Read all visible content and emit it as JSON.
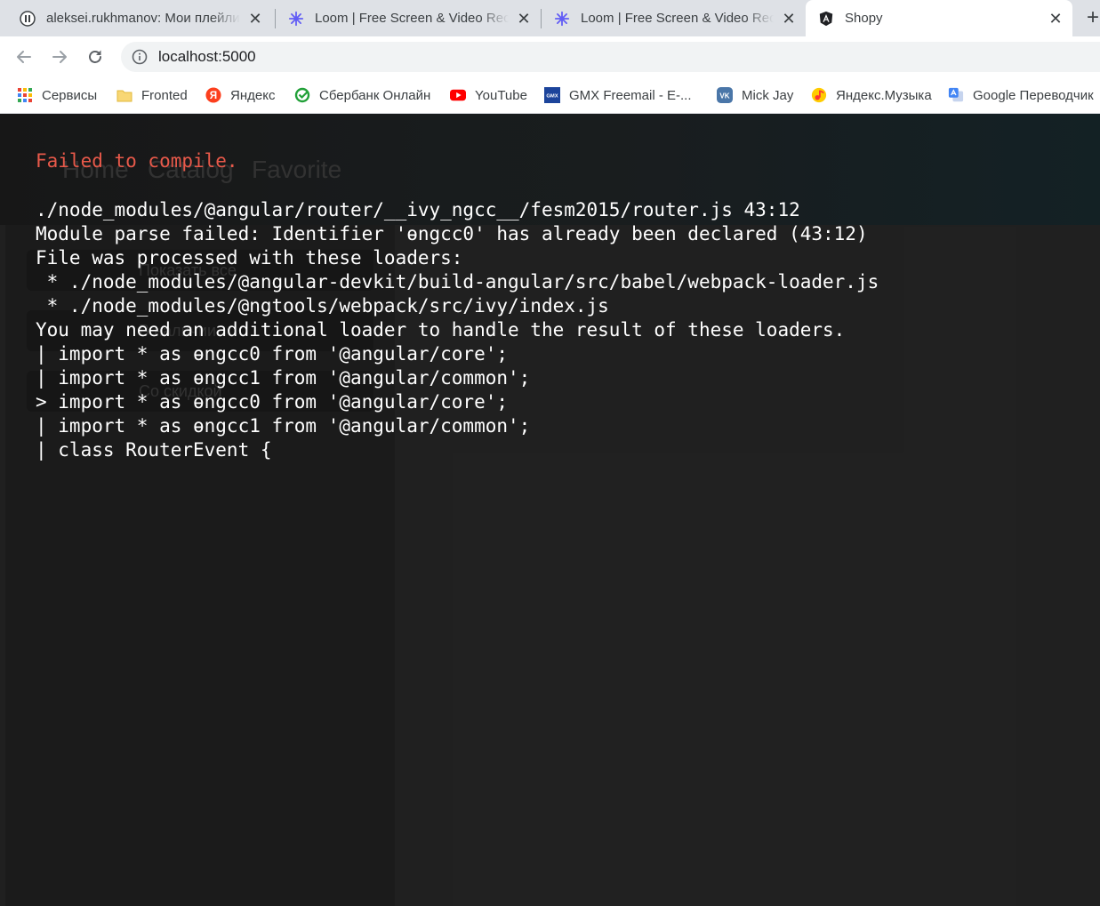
{
  "browser": {
    "tabs": [
      {
        "title": "aleksei.rukhmanov: Мои плейлисты",
        "icon": "pause-icon",
        "active": false
      },
      {
        "title": "Loom | Free Screen & Video Recording",
        "icon": "loom-icon",
        "active": false
      },
      {
        "title": "Loom | Free Screen & Video Recording",
        "icon": "loom-icon",
        "active": false
      },
      {
        "title": "Shopy",
        "icon": "angular-icon",
        "active": true
      }
    ],
    "new_tab": "+",
    "close_glyph": "✕",
    "url": "localhost:5000",
    "bookmarks": [
      {
        "label": "Сервисы",
        "icon": "apps-grid-icon"
      },
      {
        "label": "Fronted",
        "icon": "folder-icon"
      },
      {
        "label": "Яндекс",
        "icon": "yandex-icon"
      },
      {
        "label": "Сбербанк Онлайн",
        "icon": "sberbank-icon"
      },
      {
        "label": "YouTube",
        "icon": "youtube-icon"
      },
      {
        "label": "GMX Freemail - E-...",
        "icon": "gmx-icon"
      },
      {
        "label": "Mick Jay",
        "icon": "vk-icon"
      },
      {
        "label": "Яндекс.Музыка",
        "icon": "yandex-music-icon"
      },
      {
        "label": "Google Переводчик",
        "icon": "google-translate-icon"
      }
    ],
    "icon_texts": {
      "yandex": "Я",
      "gmx": "GMX",
      "vk": "VK"
    }
  },
  "app": {
    "nav": [
      "Home",
      "Catalog",
      "Favorite"
    ],
    "side_buttons": [
      "Показать все",
      "В наличии",
      "Со скидкой"
    ]
  },
  "overlay": {
    "title": "Failed to compile.",
    "lines": [
      "./node_modules/@angular/router/__ivy_ngcc__/fesm2015/router.js 43:12",
      "Module parse failed: Identifier 'ɵngcc0' has already been declared (43:12)",
      "File was processed with these loaders:",
      " * ./node_modules/@angular-devkit/build-angular/src/babel/webpack-loader.js",
      " * ./node_modules/@ngtools/webpack/src/ivy/index.js",
      "You may need an additional loader to handle the result of these loaders.",
      "| import * as ɵngcc0 from '@angular/core';",
      "| import * as ɵngcc1 from '@angular/common';",
      "> import * as ɵngcc0 from '@angular/core';",
      "| import * as ɵngcc1 from '@angular/common';",
      "| class RouterEvent {"
    ],
    "colors": {
      "title": "#e8594a",
      "text": "#ffffff",
      "background": "#252525"
    }
  }
}
